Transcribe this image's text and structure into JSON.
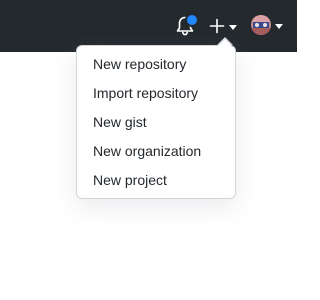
{
  "header": {
    "background": "#24292e",
    "notification_icon": "bell-icon",
    "notification_indicator_color": "#2188ff",
    "create_icon": "plus-icon",
    "create_caret_icon": "caret-down-icon",
    "avatar_caret_icon": "caret-down-icon"
  },
  "create_menu": {
    "items": [
      {
        "label": "New repository"
      },
      {
        "label": "Import repository"
      },
      {
        "label": "New gist"
      },
      {
        "label": "New organization"
      },
      {
        "label": "New project"
      }
    ]
  }
}
